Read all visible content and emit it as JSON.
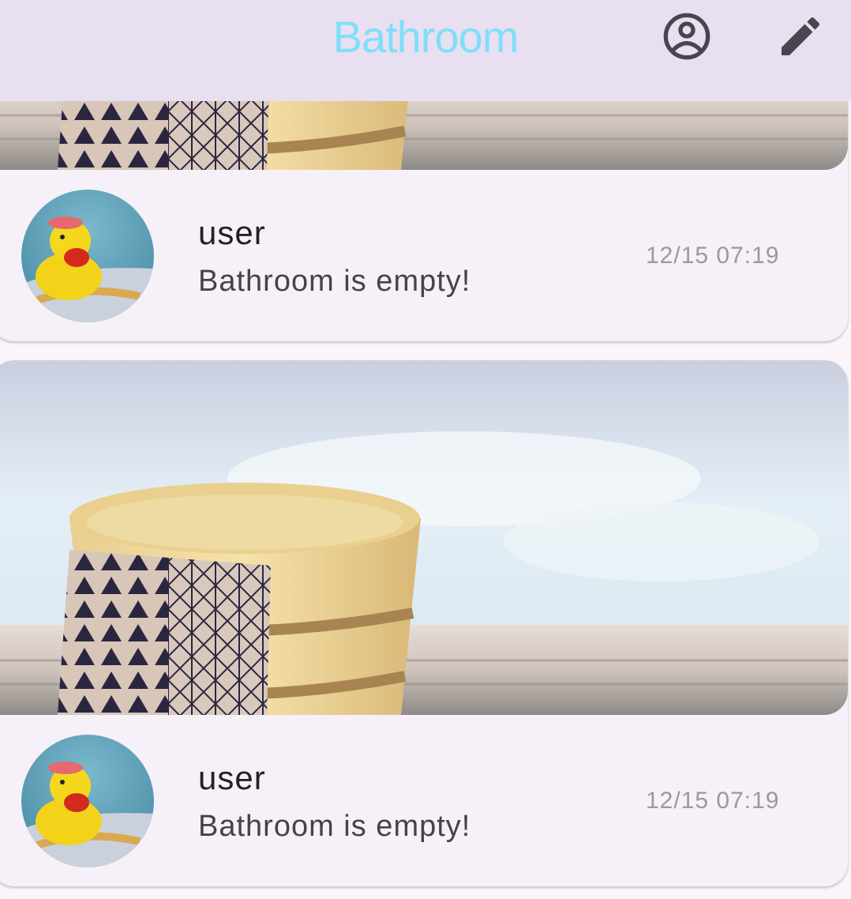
{
  "appbar": {
    "title": "Bathroom",
    "icons": [
      "account-circle-icon",
      "edit-pencil-icon"
    ],
    "title_color": "#80def8"
  },
  "posts": [
    {
      "username": "user",
      "message": "Bathroom is empty!",
      "timestamp": "12/15 07:19"
    },
    {
      "username": "user",
      "message": "Bathroom is empty!",
      "timestamp": "12/15 07:19"
    }
  ]
}
